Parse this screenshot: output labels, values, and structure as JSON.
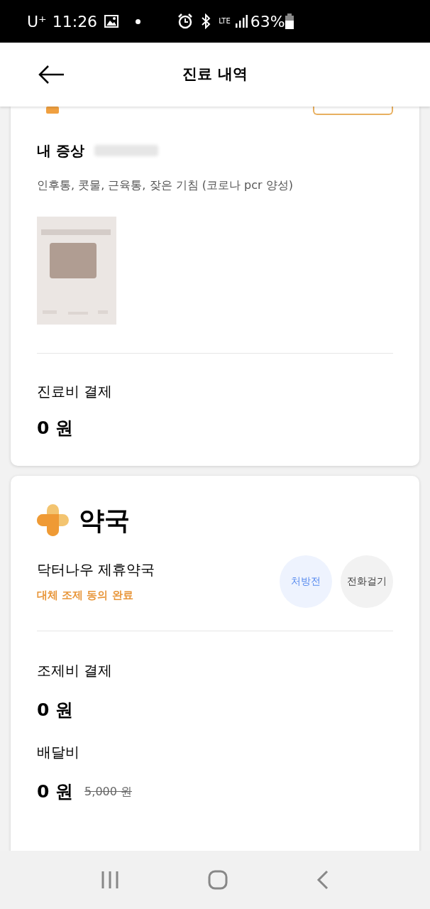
{
  "status_bar": {
    "carrier": "U⁺",
    "time": "11:26",
    "network": "LTE",
    "battery": "63%"
  },
  "header": {
    "title": "진료 내역"
  },
  "clinic_card": {
    "symptoms_label": "내 증상",
    "symptoms": "인후통, 콧물, 근육통, 잦은 기침 (코로나 pcr 양성)",
    "fee_label": "진료비 결제",
    "fee": "0 원"
  },
  "pharmacy_card": {
    "title": "약국",
    "pharmacy_name": "닥터나우 제휴약국",
    "status": "대체 조제 동의 완료",
    "buttons": [
      {
        "label": "처방전",
        "kind": "primary"
      },
      {
        "label": "전화걸기",
        "kind": "secondary"
      }
    ],
    "fee_label": "조제비 결제",
    "fee": "0 원",
    "delivery_label": "배달비",
    "delivery_fee": "0 원",
    "delivery_original_fee": "5,000 원"
  }
}
